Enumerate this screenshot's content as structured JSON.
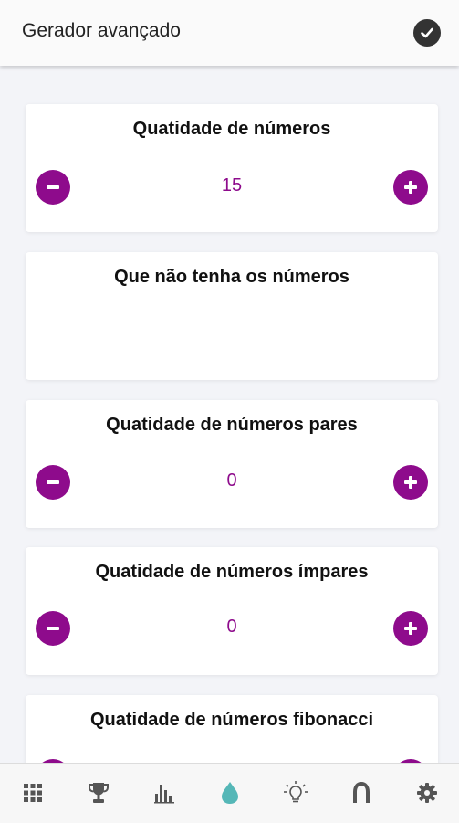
{
  "app_bar": {
    "title": "Gerador avançado",
    "confirm_icon": "check-circle-icon"
  },
  "cards": [
    {
      "title": "Quatidade de números",
      "value": "15",
      "has_stepper": true
    },
    {
      "title": "Que não tenha os números",
      "has_stepper": false
    },
    {
      "title": "Quatidade de números pares",
      "value": "0",
      "has_stepper": true
    },
    {
      "title": "Quatidade de números ímpares",
      "value": "0",
      "has_stepper": true
    },
    {
      "title": "Quatidade de números fibonacci",
      "has_stepper": true
    }
  ],
  "bottom_nav": {
    "items": [
      {
        "icon": "grid-icon",
        "active": false
      },
      {
        "icon": "trophy-icon",
        "active": false
      },
      {
        "icon": "bar-chart-icon",
        "active": false
      },
      {
        "icon": "drop-icon",
        "active": true
      },
      {
        "icon": "lightbulb-icon",
        "active": false
      },
      {
        "icon": "horseshoe-icon",
        "active": false
      },
      {
        "icon": "gear-icon",
        "active": false
      }
    ]
  },
  "colors": {
    "accent": "#8e0b8c",
    "active_nav": "#55b7b7",
    "nav_icon": "#555555",
    "background": "#f3f4f8"
  }
}
